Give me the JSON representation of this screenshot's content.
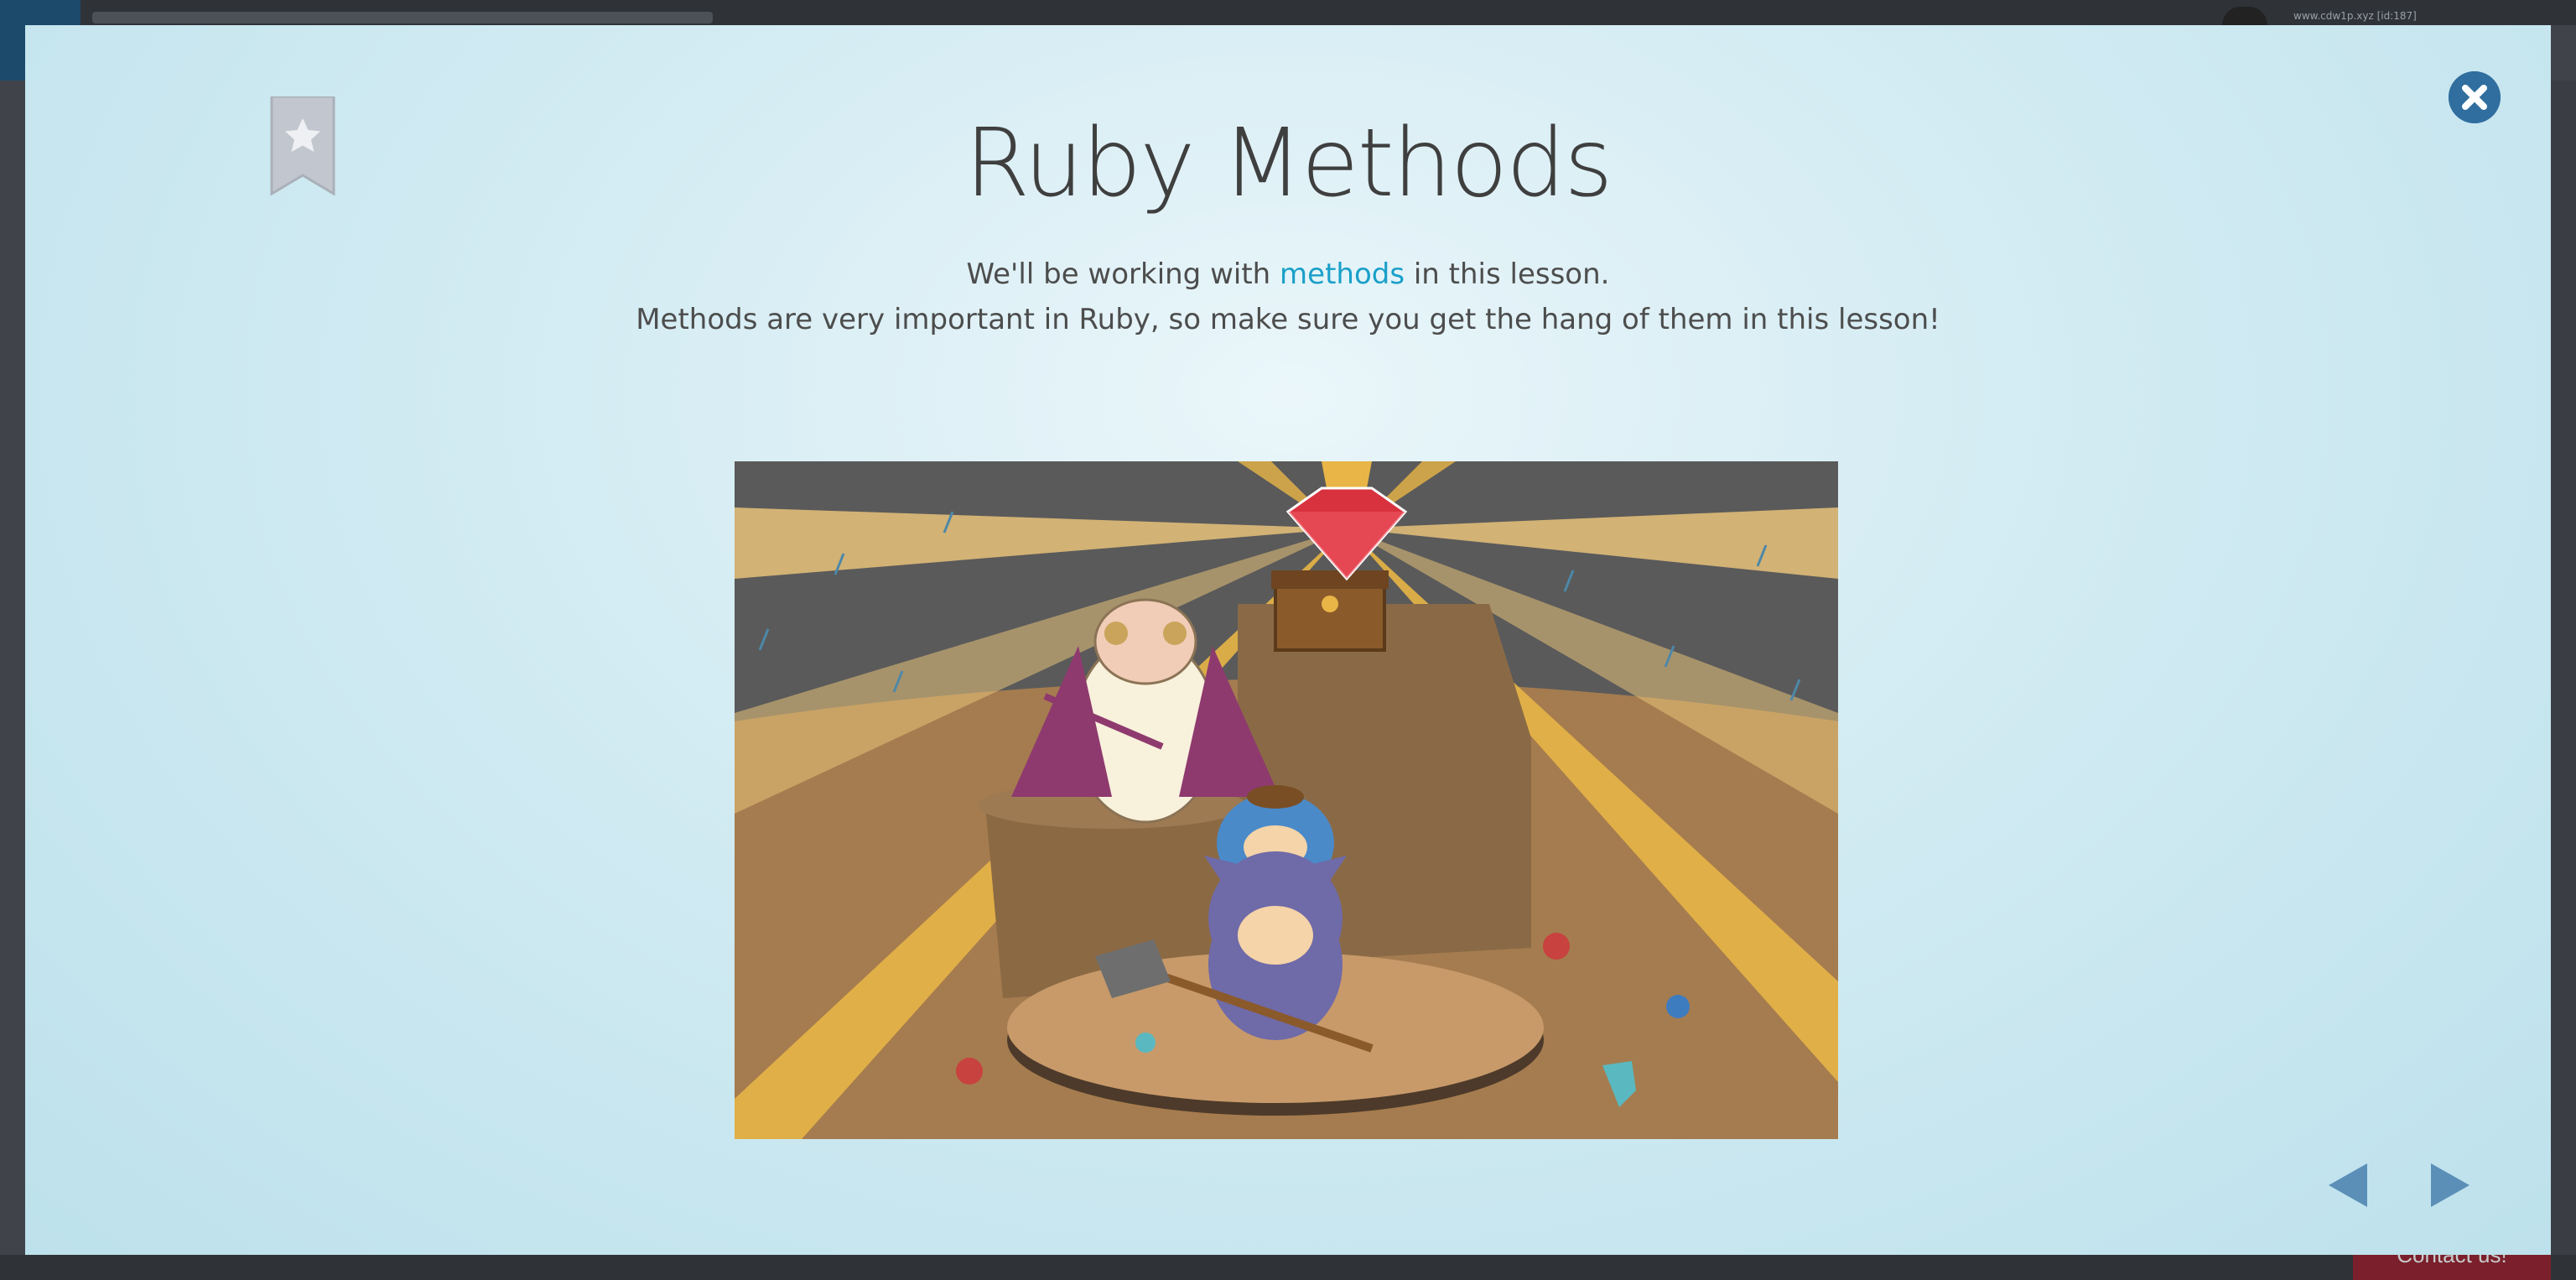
{
  "modal": {
    "title": "Ruby Methods",
    "description": {
      "line1_before": "We'll be working with ",
      "line1_link": "methods",
      "line1_after": " in this lesson.",
      "line2": "Methods are very important in Ruby, so make sure you get the hang of them in this lesson!"
    },
    "illustration_alt": "",
    "icons": {
      "bookmark": "bookmark-star-icon",
      "close": "close-icon",
      "prev": "arrow-left-icon",
      "next": "arrow-right-icon"
    },
    "colors": {
      "accent_link": "#1aa0c9",
      "close_button": "#2f6e9e",
      "nav_arrow": "#5b8fb8",
      "bookmark": "#b9bfc8"
    }
  },
  "background": {
    "user_text": "www.cdw1p.xyz [id:187]",
    "contact_label": "Contact us!"
  }
}
